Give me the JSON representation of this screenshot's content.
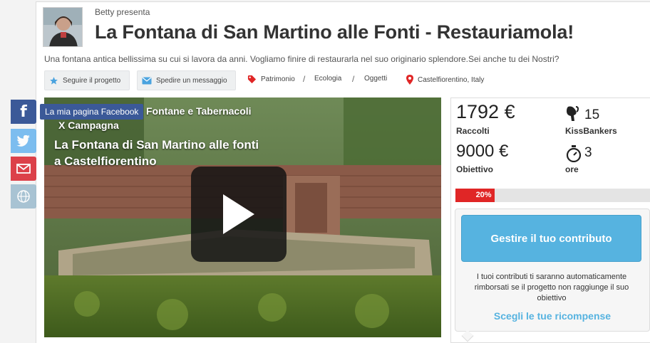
{
  "header": {
    "presenter": "Betty presenta",
    "title": "La Fontana di San Martino alle Fonti - Restauriamola!",
    "description": "Una fontana antica bellissima su cui si lavora da anni. Vogliamo finire di restaurarla nel suo originario splendore.Sei anche tu dei Nostri?"
  },
  "actions": {
    "follow": "Seguire il progetto",
    "message": "Spedire un messaggio"
  },
  "tags": {
    "items": [
      "Patrimonio",
      "Ecologia",
      "Oggetti"
    ],
    "separator": "/",
    "location": "Castelfiorentino, Italy"
  },
  "social": {
    "facebook_tooltip": "La mia pagina Facebook",
    "icons": [
      "facebook-icon",
      "twitter-icon",
      "mail-icon",
      "globe-icon"
    ]
  },
  "video": {
    "line1": "Fontane e Tabernacoli",
    "line2": "X Campagna",
    "line3": "La Fontana di San Martino alle fonti",
    "line4": "a Castelfiorentino"
  },
  "stats": {
    "raised": "1792 €",
    "raised_label": "Raccolti",
    "backers": "15",
    "backers_label": "KissBankers",
    "goal": "9000 €",
    "goal_label": "Obiettivo",
    "time": "3",
    "time_label": "ore",
    "progress_label": "20%",
    "progress_value": 0.2
  },
  "contribute": {
    "button": "Gestire il tuo contributo",
    "note": "I tuoi contributi ti saranno automaticamente rimborsati se il progetto non raggiunge il suo obiettivo",
    "rewards_link": "Scegli le tue ricompense"
  },
  "colors": {
    "facebook": "#3b5998",
    "twitter": "#55acee",
    "mail": "#d9232d",
    "accent_blue": "#56b3e0",
    "progress_red": "#e02626"
  }
}
